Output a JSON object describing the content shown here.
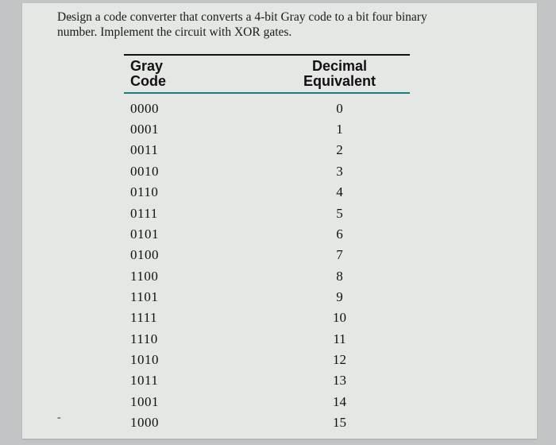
{
  "problem": {
    "bullet": "-",
    "line1": "Design a code converter that converts a 4-bit Gray code to a bit four binary",
    "line2": "number. Implement the circuit with XOR gates."
  },
  "chart_data": {
    "type": "table",
    "title": "",
    "columns": [
      "Gray Code",
      "Decimal Equivalent"
    ],
    "rows": [
      [
        "0000",
        0
      ],
      [
        "0001",
        1
      ],
      [
        "0011",
        2
      ],
      [
        "0010",
        3
      ],
      [
        "0110",
        4
      ],
      [
        "0111",
        5
      ],
      [
        "0101",
        6
      ],
      [
        "0100",
        7
      ],
      [
        "1100",
        8
      ],
      [
        "1101",
        9
      ],
      [
        "1111",
        10
      ],
      [
        "1110",
        11
      ],
      [
        "1010",
        12
      ],
      [
        "1011",
        13
      ],
      [
        "1001",
        14
      ],
      [
        "1000",
        15
      ]
    ]
  },
  "headers": {
    "gray_line1": "Gray",
    "gray_line2": "Code",
    "dec_line1": "Decimal",
    "dec_line2": "Equivalent"
  },
  "bullet2": "-"
}
